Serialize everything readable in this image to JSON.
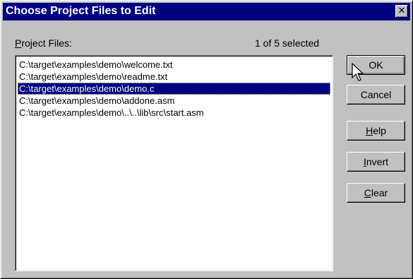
{
  "window": {
    "title": "Choose Project Files to Edit",
    "close_glyph": "✕"
  },
  "project_files": {
    "label": "Project Files:",
    "label_mnemonic": "P",
    "label_rest": "roject Files:",
    "selection_count": "1 of 5 selected",
    "items": [
      {
        "path": "C:\\target\\examples\\demo\\welcome.txt",
        "selected": false
      },
      {
        "path": "C:\\target\\examples\\demo\\readme.txt",
        "selected": false
      },
      {
        "path": "C:\\target\\examples\\demo\\demo.c",
        "selected": true
      },
      {
        "path": "C:\\target\\examples\\demo\\addone.asm",
        "selected": false
      },
      {
        "path": "C:\\target\\examples\\demo\\..\\..\\lib\\src\\start.asm",
        "selected": false
      }
    ]
  },
  "buttons": {
    "ok": "OK",
    "cancel": "Cancel",
    "help_mnemonic": "H",
    "help_rest": "elp",
    "invert_mnemonic": "I",
    "invert_rest": "nvert",
    "clear_mnemonic": "C",
    "clear_rest": "lear"
  },
  "colors": {
    "face": "#c0c0c0",
    "titlebar": "#000080",
    "selection": "#000080"
  },
  "icons": {
    "close": "close-icon",
    "cursor": "mouse-pointer-icon"
  }
}
